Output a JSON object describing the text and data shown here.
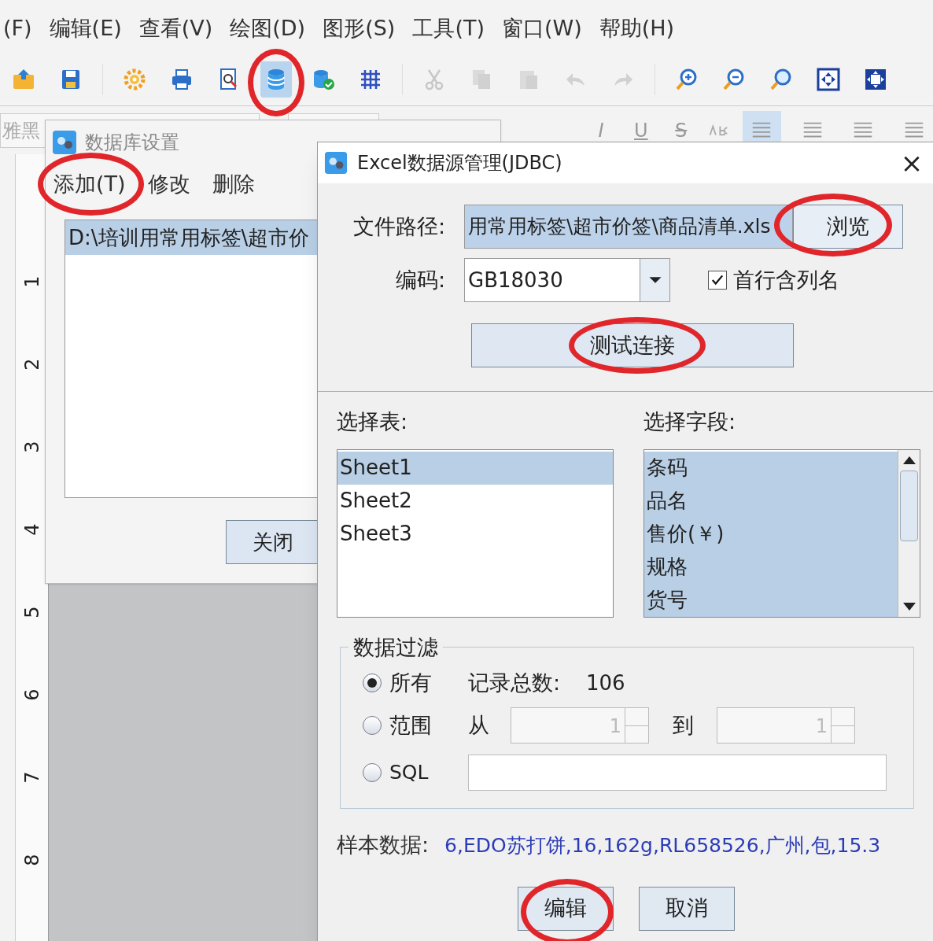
{
  "menu_bar": [
    {
      "label": "(F)"
    },
    {
      "label": "编辑(E)"
    },
    {
      "label": "查看(V)"
    },
    {
      "label": "绘图(D)"
    },
    {
      "label": "图形(S)"
    },
    {
      "label": "工具(T)"
    },
    {
      "label": "窗口(W)"
    },
    {
      "label": "帮助(H)"
    }
  ],
  "toolbar": [
    {
      "kind": "open",
      "disabled": false,
      "selected": false,
      "circled": false
    },
    {
      "kind": "save",
      "disabled": false,
      "selected": false,
      "circled": false
    },
    {
      "kind": "sep"
    },
    {
      "kind": "gear",
      "disabled": false,
      "selected": false,
      "circled": false
    },
    {
      "kind": "print",
      "disabled": false,
      "selected": false,
      "circled": false
    },
    {
      "kind": "preview",
      "disabled": false,
      "selected": false,
      "circled": false
    },
    {
      "kind": "database",
      "disabled": false,
      "selected": true,
      "circled": true
    },
    {
      "kind": "database-check",
      "disabled": false,
      "selected": false,
      "circled": false
    },
    {
      "kind": "grid",
      "disabled": false,
      "selected": false,
      "circled": false
    },
    {
      "kind": "sep"
    },
    {
      "kind": "cut",
      "disabled": true,
      "selected": false,
      "circled": false
    },
    {
      "kind": "copy",
      "disabled": true,
      "selected": false,
      "circled": false
    },
    {
      "kind": "paste",
      "disabled": true,
      "selected": false,
      "circled": false
    },
    {
      "kind": "undo",
      "disabled": true,
      "selected": false,
      "circled": false
    },
    {
      "kind": "redo",
      "disabled": true,
      "selected": false,
      "circled": false
    },
    {
      "kind": "sep"
    },
    {
      "kind": "zoom-in",
      "disabled": false,
      "selected": false,
      "circled": false
    },
    {
      "kind": "zoom-out",
      "disabled": false,
      "selected": false,
      "circled": false
    },
    {
      "kind": "zoom",
      "disabled": false,
      "selected": false,
      "circled": false
    },
    {
      "kind": "fit",
      "disabled": false,
      "selected": false,
      "circled": false
    },
    {
      "kind": "fit-page",
      "disabled": false,
      "selected": false,
      "circled": false
    }
  ],
  "format_bar": {
    "font": "雅黑",
    "buttons": [
      {
        "label": "I"
      },
      {
        "label": "U"
      },
      {
        "label": "S"
      }
    ],
    "align": [
      {
        "selected": true
      },
      {
        "selected": false
      },
      {
        "selected": false
      },
      {
        "selected": false
      }
    ]
  },
  "ruler": {
    "numbers": [
      "1",
      "2",
      "3",
      "4",
      "5",
      "6",
      "7",
      "8"
    ]
  },
  "database_dialog": {
    "title": "数据库设置",
    "menu": [
      {
        "label": "添加(T)",
        "circled": true
      },
      {
        "label": "修改",
        "circled": false
      },
      {
        "label": "删除",
        "circled": false
      }
    ],
    "items": [
      {
        "label": "D:\\培训用常用标签\\超市价",
        "selected": true
      }
    ],
    "close_button": "关闭"
  },
  "excel_dialog": {
    "title": "Excel数据源管理(JDBC)",
    "close": "×",
    "file_path": {
      "label": "文件路径:",
      "value": "用常用标签\\超市价签\\商品清单.xls",
      "button": "浏览",
      "circled": true
    },
    "encoding": {
      "label": "编码:",
      "value": "GB18030"
    },
    "header_row": {
      "label": "首行含列名",
      "checked": true
    },
    "test_button": {
      "label": "测试连接",
      "circled": true
    },
    "tables": {
      "label": "选择表:",
      "items": [
        {
          "label": "Sheet1",
          "selected": true
        },
        {
          "label": "Sheet2",
          "selected": false
        },
        {
          "label": "Sheet3",
          "selected": false
        }
      ]
    },
    "fields": {
      "label": "选择字段:",
      "items": [
        {
          "label": "条码",
          "selected": true
        },
        {
          "label": "品名",
          "selected": true
        },
        {
          "label": "售价(￥)",
          "selected": true
        },
        {
          "label": "规格",
          "selected": true
        },
        {
          "label": "货号",
          "selected": true
        }
      ]
    },
    "filter": {
      "label": "数据过滤",
      "all": {
        "label": "所有",
        "selected": true,
        "count_label": "记录总数:",
        "count": "106"
      },
      "range": {
        "label": "范围",
        "selected": false,
        "from_label": "从",
        "from": "1",
        "to_label": "到",
        "to": "1"
      },
      "sql": {
        "label": "SQL",
        "selected": false
      }
    },
    "sample": {
      "label": "样本数据:",
      "value": "6,EDO苏打饼,16,162g,RL658526,广州,包,15.3"
    },
    "buttons": [
      {
        "label": "编辑",
        "circled": true
      },
      {
        "label": "取消",
        "circled": false
      }
    ]
  }
}
